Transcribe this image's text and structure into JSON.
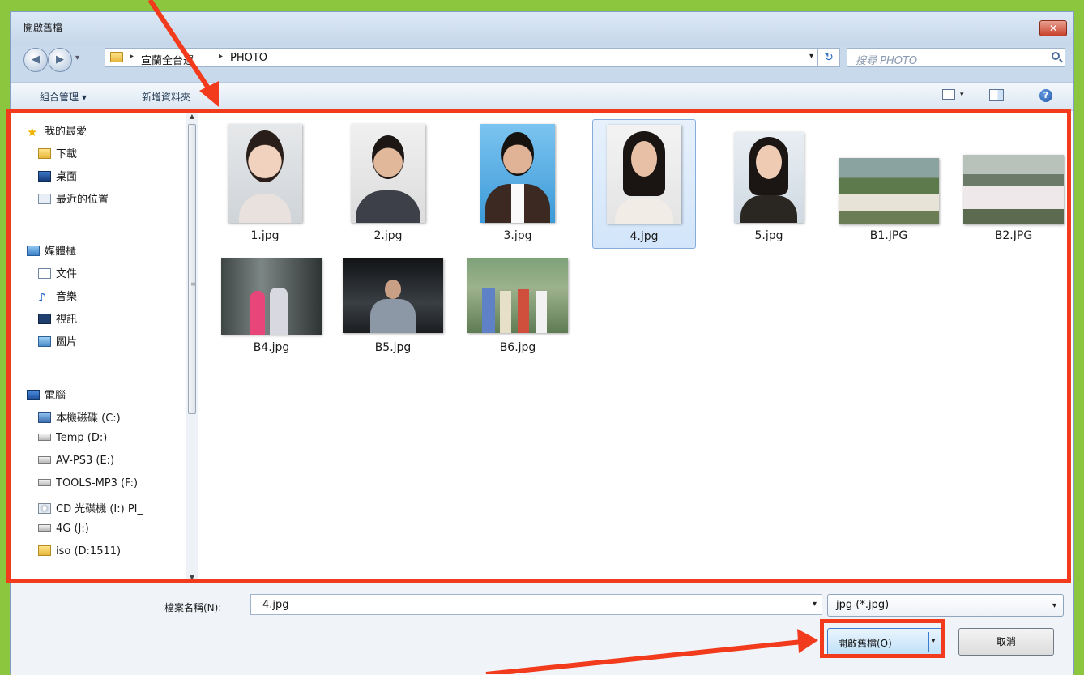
{
  "window": {
    "title": "開啟舊檔",
    "close_label": "✕"
  },
  "nav": {
    "back": "◀",
    "forward": "▶",
    "history": "▾"
  },
  "address": {
    "crumbs": [
      "宣蘭全台運",
      "PHOTO"
    ],
    "dropdown": "▾"
  },
  "refresh": "↻",
  "search": {
    "placeholder": "搜尋 PHOTO"
  },
  "toolbar": {
    "organize": "組合管理 ▾",
    "new_folder": "新增資料夾",
    "view_dd": "▾",
    "help": "?"
  },
  "sidebar": {
    "favorites": {
      "label": "我的最愛",
      "items": [
        "下載",
        "桌面",
        "最近的位置"
      ]
    },
    "libraries": {
      "label": "媒體櫃",
      "items": [
        "文件",
        "音樂",
        "視訊",
        "圖片"
      ]
    },
    "computer": {
      "label": "電腦",
      "items": [
        "本機磁碟 (C:)",
        "Temp (D:)",
        "AV-PS3 (E:)",
        "TOOLS-MP3 (F:)",
        "CD 光碟機 (I:) PI_",
        "4G (J:)",
        "iso (D:1511)"
      ]
    }
  },
  "files": [
    {
      "name": "1.jpg",
      "kind": "portrait",
      "selected": false
    },
    {
      "name": "2.jpg",
      "kind": "portrait",
      "selected": false
    },
    {
      "name": "3.jpg",
      "kind": "portrait",
      "selected": false
    },
    {
      "name": "4.jpg",
      "kind": "portrait",
      "selected": true
    },
    {
      "name": "5.jpg",
      "kind": "portrait",
      "selected": false
    },
    {
      "name": "B1.JPG",
      "kind": "group-photo",
      "selected": false
    },
    {
      "name": "B2.JPG",
      "kind": "group-photo",
      "selected": false
    },
    {
      "name": "B4.jpg",
      "kind": "landscape-photo",
      "selected": false
    },
    {
      "name": "B5.jpg",
      "kind": "landscape-photo",
      "selected": false
    },
    {
      "name": "B6.jpg",
      "kind": "landscape-photo",
      "selected": false
    }
  ],
  "filename": {
    "label": "檔案名稱(N):",
    "value": "4.jpg"
  },
  "filter": {
    "value": "jpg (*.jpg)"
  },
  "buttons": {
    "open": "開啟舊檔(O)",
    "cancel": "取消"
  },
  "colors": {
    "background": "#8cc63f",
    "highlight": "#f23a1d",
    "selection": "#d2e5fa"
  }
}
